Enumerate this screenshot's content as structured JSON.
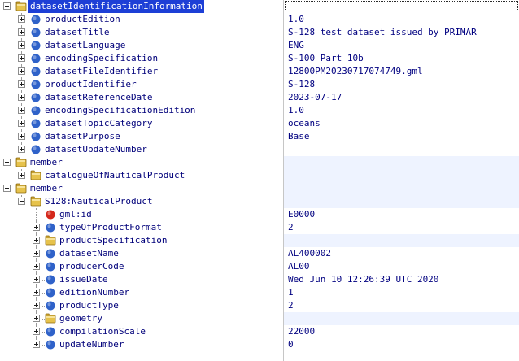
{
  "tree": {
    "colors": {
      "folder": "#e6c24b",
      "element": "#2f62c9",
      "attribute": "#d4281b",
      "selection": "#1d3fd6",
      "shade": "#eef3ff"
    },
    "nodes": [
      {
        "depth": 0,
        "expander": "minus",
        "icon": "folder-icon",
        "label": "datasetIdentificationInformation",
        "value": "",
        "selected": true,
        "shade": false
      },
      {
        "depth": 1,
        "expander": "plus",
        "icon": "element-icon",
        "label": "productEdition",
        "value": "1.0",
        "shade": false
      },
      {
        "depth": 1,
        "expander": "plus",
        "icon": "element-icon",
        "label": "datasetTitle",
        "value": "S-128 test dataset issued by PRIMAR",
        "shade": false
      },
      {
        "depth": 1,
        "expander": "plus",
        "icon": "element-icon",
        "label": "datasetLanguage",
        "value": "ENG",
        "shade": false
      },
      {
        "depth": 1,
        "expander": "plus",
        "icon": "element-icon",
        "label": "encodingSpecification",
        "value": "S-100 Part 10b",
        "shade": false
      },
      {
        "depth": 1,
        "expander": "plus",
        "icon": "element-icon",
        "label": "datasetFileIdentifier",
        "value": "12800PM20230717074749.gml",
        "shade": false
      },
      {
        "depth": 1,
        "expander": "plus",
        "icon": "element-icon",
        "label": "productIdentifier",
        "value": "S-128",
        "shade": false
      },
      {
        "depth": 1,
        "expander": "plus",
        "icon": "element-icon",
        "label": "datasetReferenceDate",
        "value": "2023-07-17",
        "shade": false
      },
      {
        "depth": 1,
        "expander": "plus",
        "icon": "element-icon",
        "label": "encodingSpecificationEdition",
        "value": "1.0",
        "shade": false
      },
      {
        "depth": 1,
        "expander": "plus",
        "icon": "element-icon",
        "label": "datasetTopicCategory",
        "value": "oceans",
        "shade": false
      },
      {
        "depth": 1,
        "expander": "plus",
        "icon": "element-icon",
        "label": "datasetPurpose",
        "value": "Base",
        "shade": false
      },
      {
        "depth": 1,
        "expander": "plus",
        "icon": "element-icon",
        "label": "datasetUpdateNumber",
        "value": "",
        "shade": false
      },
      {
        "depth": 0,
        "expander": "minus",
        "icon": "folder-icon",
        "label": "member",
        "value": "",
        "shade": true
      },
      {
        "depth": 1,
        "expander": "plus",
        "icon": "folder-icon",
        "label": "catalogueOfNauticalProduct",
        "value": "",
        "shade": true
      },
      {
        "depth": 0,
        "expander": "minus",
        "icon": "folder-icon",
        "label": "member",
        "value": "",
        "shade": true
      },
      {
        "depth": 1,
        "expander": "minus",
        "icon": "folder-icon",
        "label": "S128:NauticalProduct",
        "value": "",
        "shade": true
      },
      {
        "depth": 2,
        "expander": "none",
        "icon": "attribute-icon",
        "label": "gml:id",
        "value": "E0000",
        "shade": false
      },
      {
        "depth": 2,
        "expander": "plus",
        "icon": "element-icon",
        "label": "typeOfProductFormat",
        "value": "2",
        "shade": false
      },
      {
        "depth": 2,
        "expander": "plus",
        "icon": "folder-icon",
        "label": "productSpecification",
        "value": "",
        "shade": true
      },
      {
        "depth": 2,
        "expander": "plus",
        "icon": "element-icon",
        "label": "datasetName",
        "value": "AL400002",
        "shade": false
      },
      {
        "depth": 2,
        "expander": "plus",
        "icon": "element-icon",
        "label": "producerCode",
        "value": "AL00",
        "shade": false
      },
      {
        "depth": 2,
        "expander": "plus",
        "icon": "element-icon",
        "label": "issueDate",
        "value": "Wed Jun 10 12:26:39 UTC 2020",
        "shade": false
      },
      {
        "depth": 2,
        "expander": "plus",
        "icon": "element-icon",
        "label": "editionNumber",
        "value": "1",
        "shade": false
      },
      {
        "depth": 2,
        "expander": "plus",
        "icon": "element-icon",
        "label": "productType",
        "value": "2",
        "shade": false
      },
      {
        "depth": 2,
        "expander": "plus",
        "icon": "folder-icon",
        "label": "geometry",
        "value": "",
        "shade": true
      },
      {
        "depth": 2,
        "expander": "plus",
        "icon": "element-icon",
        "label": "compilationScale",
        "value": "22000",
        "shade": false
      },
      {
        "depth": 2,
        "expander": "plus",
        "icon": "element-icon",
        "label": "updateNumber",
        "value": "0",
        "shade": false
      }
    ]
  }
}
